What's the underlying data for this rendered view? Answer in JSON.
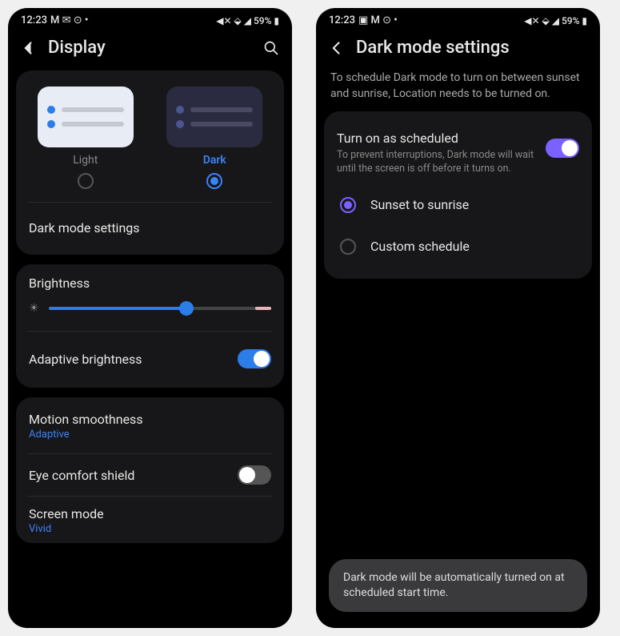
{
  "status": {
    "time": "12:23",
    "icons_left": "M ✉ ⊙ •",
    "icons_left2": "▣ M ⊙ •",
    "right": "◀✕ ⬙ ◢ 59% ▮"
  },
  "left": {
    "title": "Display",
    "theme": {
      "light": "Light",
      "dark": "Dark"
    },
    "dark_mode_settings": "Dark mode settings",
    "brightness": "Brightness",
    "adaptive_brightness": "Adaptive brightness",
    "motion_smoothness": "Motion smoothness",
    "motion_value": "Adaptive",
    "eye_comfort": "Eye comfort shield",
    "screen_mode": "Screen mode",
    "screen_mode_value": "Vivid"
  },
  "right": {
    "title": "Dark mode settings",
    "info": "To schedule Dark mode to turn on between sunset and sunrise, Location needs to be turned on.",
    "turn_on": "Turn on as scheduled",
    "turn_on_desc": "To prevent interruptions, Dark mode will wait until the screen is off before it turns on.",
    "opt1": "Sunset to sunrise",
    "opt2": "Custom schedule",
    "toast": "Dark mode will be automatically turned on at scheduled start time."
  }
}
